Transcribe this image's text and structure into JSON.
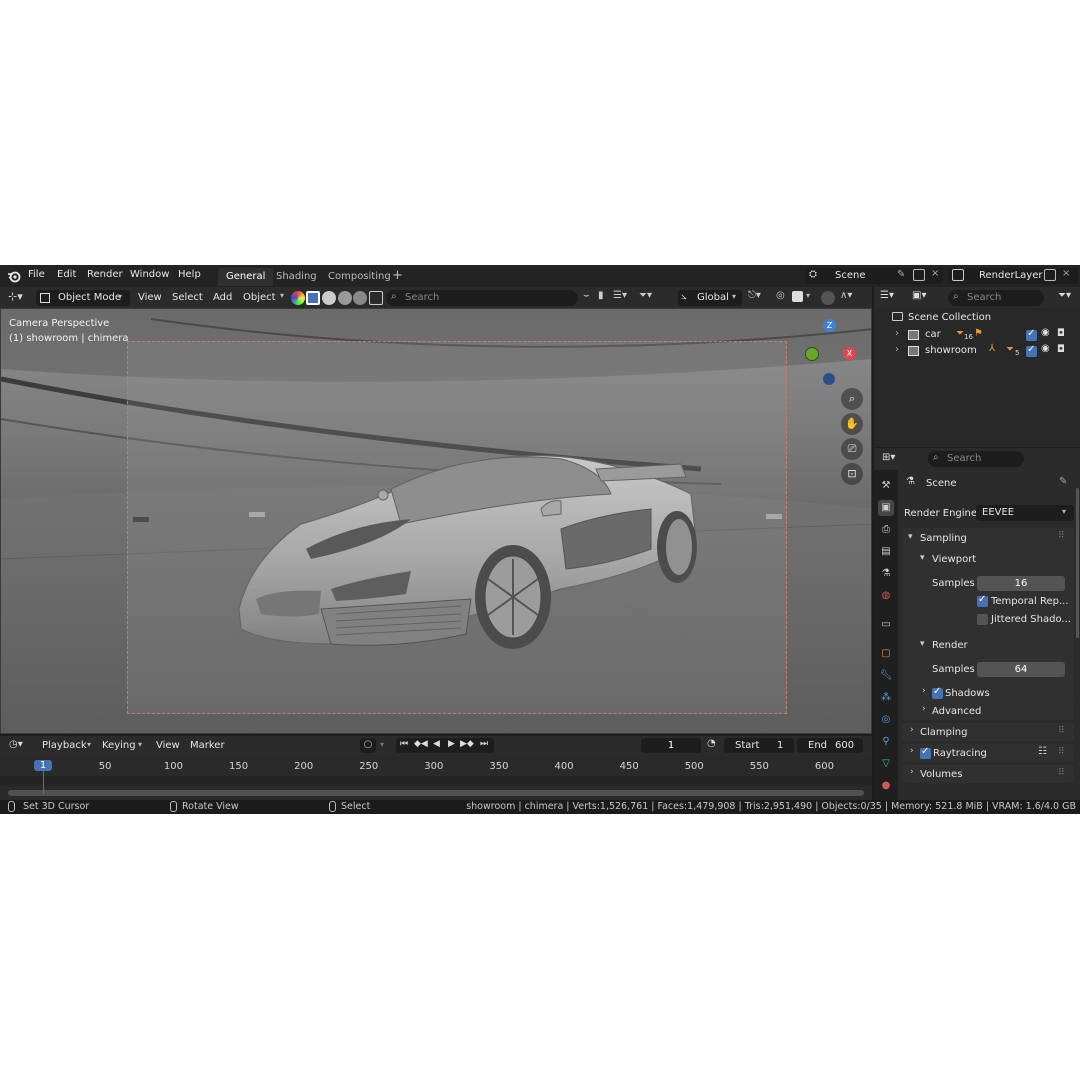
{
  "topbar": {
    "menus": [
      "File",
      "Edit",
      "Render",
      "Window",
      "Help"
    ],
    "workspaces": [
      "General",
      "Shading",
      "Compositing"
    ],
    "active_workspace": "General",
    "scene": "Scene",
    "render_layer": "RenderLayer"
  },
  "viewport_header": {
    "mode": "Object Mode",
    "menus": [
      "View",
      "Select",
      "Add",
      "Object"
    ],
    "search_placeholder": "Search",
    "transform_orientation": "Global"
  },
  "viewport": {
    "camera_label": "Camera Perspective",
    "object_label": "(1) showroom | chimera",
    "gizmo": {
      "z": "Z",
      "x": "X"
    }
  },
  "outliner": {
    "search_placeholder": "Search",
    "root": "Scene Collection",
    "items": [
      {
        "name": "car",
        "badge": "16"
      },
      {
        "name": "showroom",
        "badge": "5"
      }
    ]
  },
  "properties": {
    "search_placeholder": "Search",
    "context": "Scene",
    "render_engine_label": "Render Engine",
    "render_engine": "EEVEE",
    "sections": {
      "sampling": "Sampling",
      "viewport": "Viewport",
      "viewport_samples_label": "Samples",
      "viewport_samples": "16",
      "temporal": "Temporal Rep...",
      "jittered": "Jittered Shado...",
      "render": "Render",
      "render_samples_label": "Samples",
      "render_samples": "64",
      "shadows": "Shadows",
      "advanced": "Advanced",
      "clamping": "Clamping",
      "raytracing": "Raytracing",
      "volumes": "Volumes"
    },
    "checks": {
      "temporal": true,
      "jittered": false,
      "shadows": true,
      "raytracing": true
    }
  },
  "timeline": {
    "menus": [
      "Playback",
      "Keying",
      "View",
      "Marker"
    ],
    "current_frame": "1",
    "start_label": "Start",
    "start": "1",
    "end_label": "End",
    "end": "600",
    "ticks": [
      "1",
      "50",
      "100",
      "150",
      "200",
      "250",
      "300",
      "350",
      "400",
      "450",
      "500",
      "550",
      "600"
    ]
  },
  "statusbar": {
    "hint1": "Set 3D Cursor",
    "hint2": "Rotate View",
    "hint3": "Select",
    "stats": "showroom | chimera | Verts:1,526,761 | Faces:1,479,908 | Tris:2,951,490 | Objects:0/35 | Memory: 521.8 MiB | VRAM: 1.6/4.0 GB"
  },
  "colors": {
    "accent": "#4772b3",
    "axis_x": "#e5434d",
    "axis_y": "#6aa82c",
    "axis_z": "#3f7fd6"
  }
}
